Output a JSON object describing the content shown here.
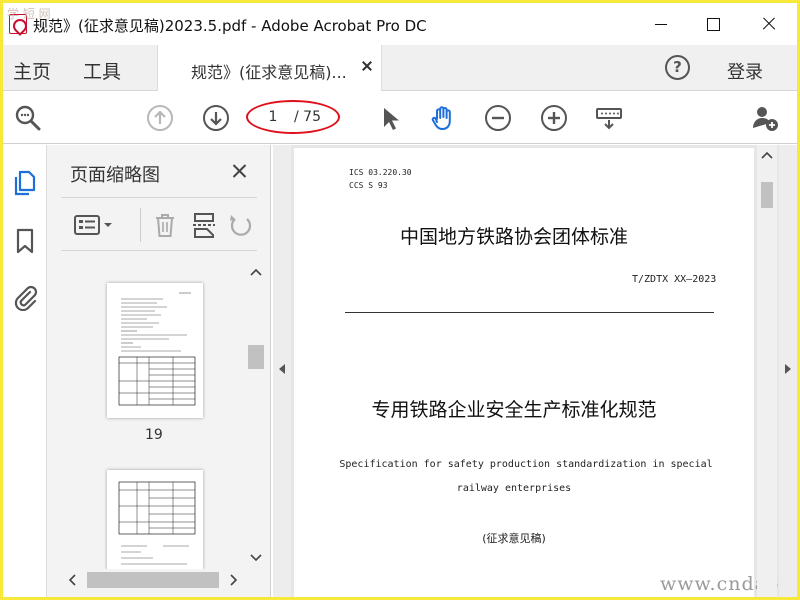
{
  "window": {
    "title": "规范》(征求意见稿)2023.5.pdf - Adobe Acrobat Pro DC",
    "watermark_top": "学 短 网"
  },
  "tabbar": {
    "home": "主页",
    "tools": "工具",
    "doc_tab": "规范》(征求意见稿)...",
    "login": "登录",
    "help": "?"
  },
  "toolbar": {
    "page_current": "1",
    "page_total": "/ 75",
    "highlight_color": "#e0101b"
  },
  "thumbnails": {
    "title": "页面缩略图",
    "page_label": "19"
  },
  "document": {
    "ics": "ICS 03.220.30",
    "ccs": "CCS S 93",
    "association": "中国地方铁路协会团体标准",
    "code": "T/ZDTX XX—2023",
    "main_title": "专用铁路企业安全生产标准化规范",
    "en_title_line1": "Specification for safety production standardization in special",
    "en_title_line2": "railway enterprises",
    "draft_note": "(征求意见稿)"
  },
  "watermark_bottom": "www.cndao.com",
  "icons": [
    "find-icon",
    "page-up-icon",
    "page-down-icon",
    "select-cursor-icon",
    "hand-tool-icon",
    "zoom-out-icon",
    "zoom-in-icon",
    "keyboard-icon",
    "add-user-icon",
    "pages-icon",
    "bookmark-icon",
    "attachment-icon",
    "page-options-icon",
    "delete-icon",
    "extract-icon",
    "rotate-icon"
  ],
  "colors": {
    "border": "#f7e83a",
    "accent": "#1e6fd9",
    "pdf_red": "#c8102e"
  }
}
